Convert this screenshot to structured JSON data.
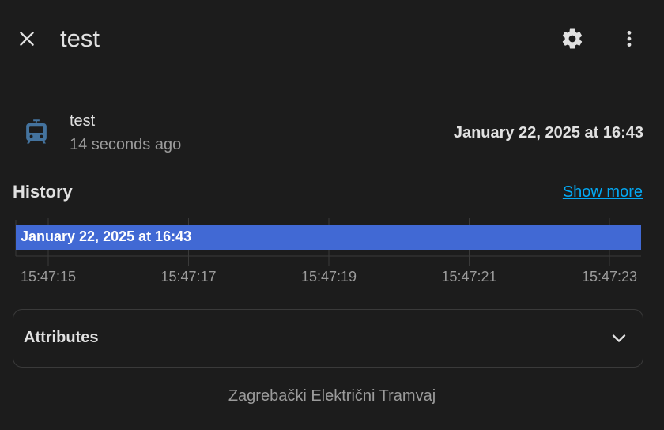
{
  "dialog": {
    "title": "test"
  },
  "header": {
    "close_icon": "close-icon",
    "settings_icon": "gear-icon",
    "menu_icon": "more-vertical-icon"
  },
  "entity": {
    "icon": "tram-icon",
    "icon_color": "#44739e",
    "name": "test",
    "secondary": "14 seconds ago",
    "state": "January 22, 2025 at 16:43"
  },
  "history": {
    "title": "History",
    "show_more": "Show more",
    "timeline": {
      "bar_label": "January 22, 2025 at 16:43",
      "bar_color": "#4169d4",
      "ticks": [
        "15:47:15",
        "15:47:17",
        "15:47:19",
        "15:47:21",
        "15:47:23"
      ]
    }
  },
  "attributes": {
    "label": "Attributes",
    "chevron_icon": "chevron-down-icon"
  },
  "attribution": "Zagrebački Električni Tramvaj",
  "colors": {
    "background": "#1c1c1c",
    "link": "#03a9f4",
    "text_secondary": "#9b9b9b"
  }
}
